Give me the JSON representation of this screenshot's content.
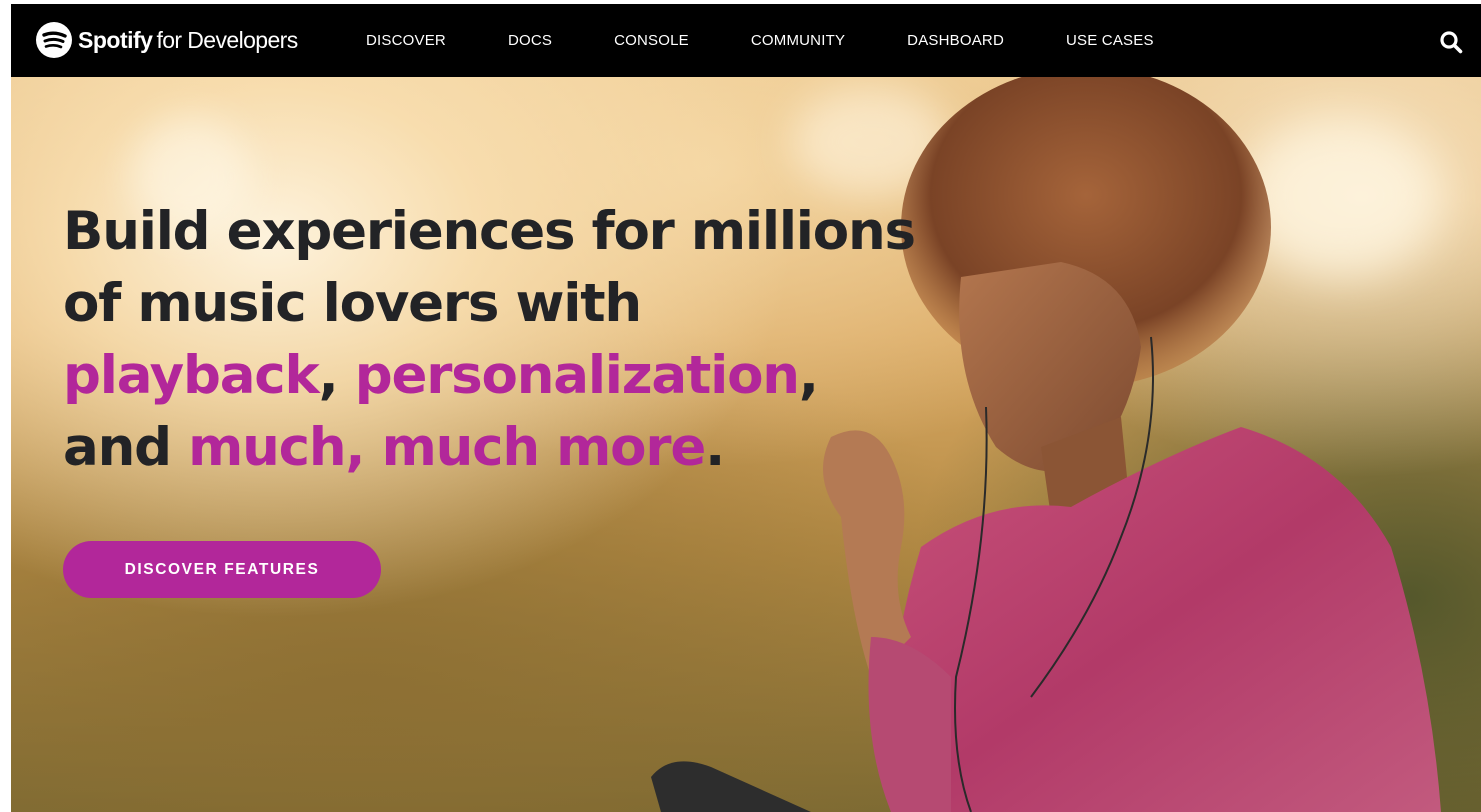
{
  "nav": {
    "brand": "Spotify",
    "brand_sub": "for Developers",
    "links": [
      "DISCOVER",
      "DOCS",
      "CONSOLE",
      "COMMUNITY",
      "DASHBOARD",
      "USE CASES"
    ],
    "search_icon": "search-icon"
  },
  "hero": {
    "line1": "Build experiences for millions",
    "line2": "of music lovers with",
    "line3_a": "playback",
    "line3_b": ", ",
    "line3_c": "personalization",
    "line3_d": ",",
    "line4_a": "and ",
    "line4_b": "much, much more",
    "line4_c": ".",
    "cta_label": "DISCOVER FEATURES"
  },
  "colors": {
    "accent": "#b2279a",
    "nav_bg": "#000000",
    "headline": "#222326"
  }
}
